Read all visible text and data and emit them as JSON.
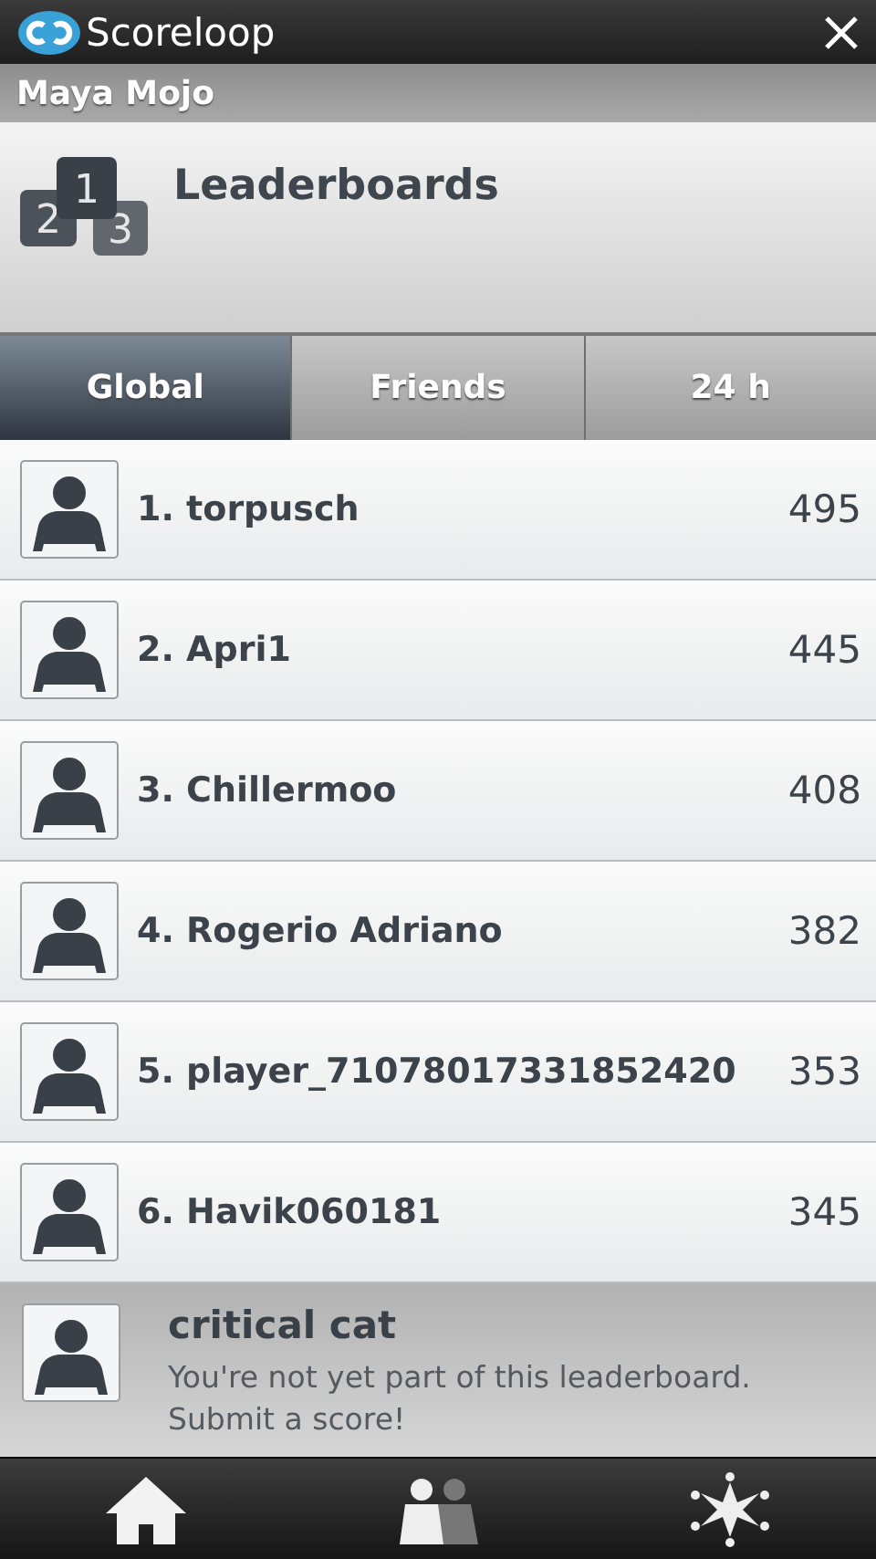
{
  "app_bar": {
    "title": "Scoreloop"
  },
  "user": {
    "name": "Maya Mojo"
  },
  "header": {
    "title": "Leaderboards",
    "rank_tiles": [
      "2",
      "3",
      "1"
    ]
  },
  "tabs": [
    {
      "label": "Global",
      "selected": true
    },
    {
      "label": "Friends",
      "selected": false
    },
    {
      "label": "24 h",
      "selected": false
    }
  ],
  "rows": [
    {
      "name": "1. torpusch",
      "score": "495"
    },
    {
      "name": "2. Apri1",
      "score": "445"
    },
    {
      "name": "3. Chillermoo",
      "score": "408"
    },
    {
      "name": "4. Rogerio Adriano",
      "score": "382"
    },
    {
      "name": "5. player_71078017331852420",
      "score": "353"
    },
    {
      "name": "6. Havik060181",
      "score": "345"
    }
  ],
  "own_entry": {
    "name": "critical cat",
    "message": "You're not yet part of this leaderboard. Submit a score!"
  }
}
